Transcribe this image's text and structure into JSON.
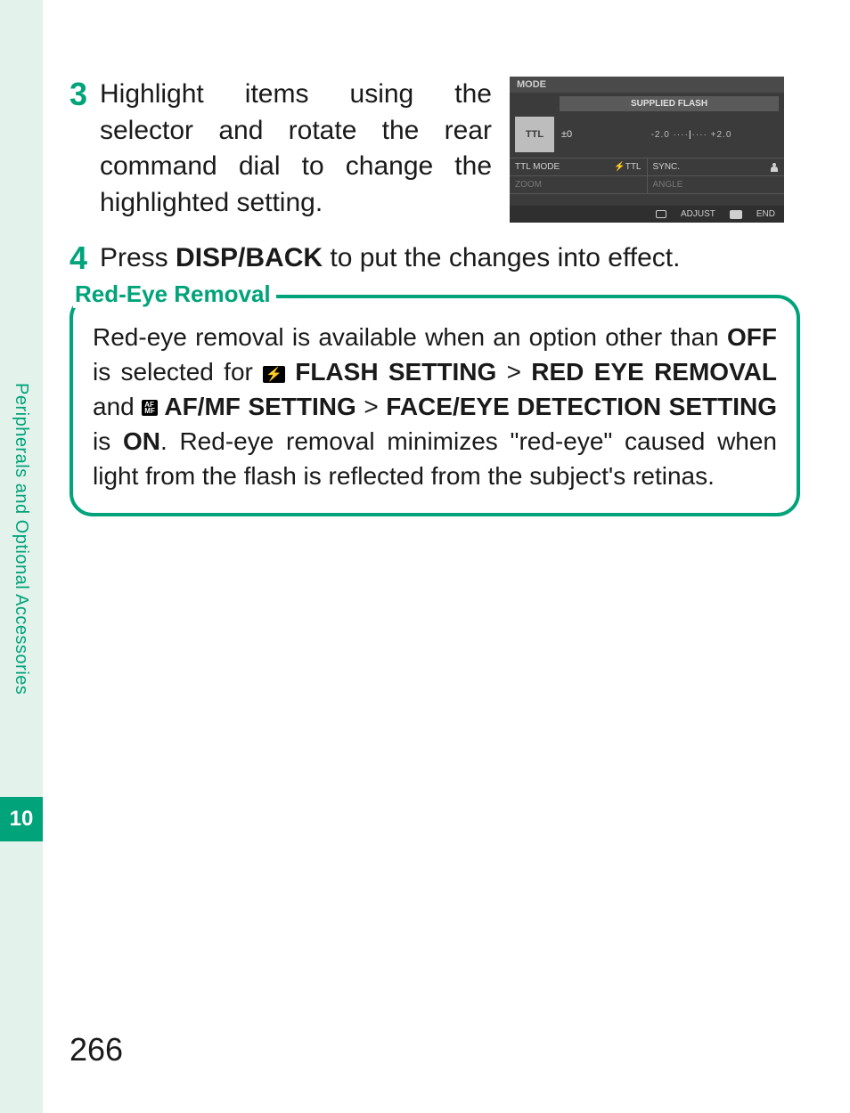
{
  "sidebar": {
    "section_title": "Peripherals and Optional Accessories",
    "chapter_number": "10"
  },
  "steps": {
    "s3": {
      "num": "3",
      "text": "Highlight items using the selector and rotate the rear command dial to change the highlighted setting."
    },
    "s4": {
      "num": "4",
      "pre": "Press ",
      "bold": "DISP/BACK",
      "post": " to put the changes into effect."
    }
  },
  "lcd": {
    "mode": "MODE",
    "supplied": "SUPPLIED FLASH",
    "ttl": "TTL",
    "val": "±0",
    "scale_l": "-2.0",
    "scale_r": "+2.0",
    "ttl_mode_label": "TTL MODE",
    "ttl_mode_val": "TTL",
    "sync_label": "SYNC.",
    "zoom_label": "ZOOM",
    "angle_label": "ANGLE",
    "adjust": "ADJUST",
    "end": "END"
  },
  "callout": {
    "title": "Red-Eye Removal",
    "t1": "Red-eye removal is available when an option other than ",
    "off": "OFF",
    "t2": " is selected for ",
    "flash_setting": " FLASH SETTING",
    "gt1": " > ",
    "red_eye": "RED EYE REMOVAL",
    "and": " and ",
    "afmf_icon": "AF MF",
    "afmf": " AF/MF SETTING",
    "gt2": " > ",
    "face_eye": "FACE/EYE DETECTION SETTING",
    "is": " is ",
    "on": "ON",
    "t3": ". Red-eye removal minimizes \"red-eye\" caused when light from the flash is reflected from the subject's retinas."
  },
  "page_number": "266"
}
